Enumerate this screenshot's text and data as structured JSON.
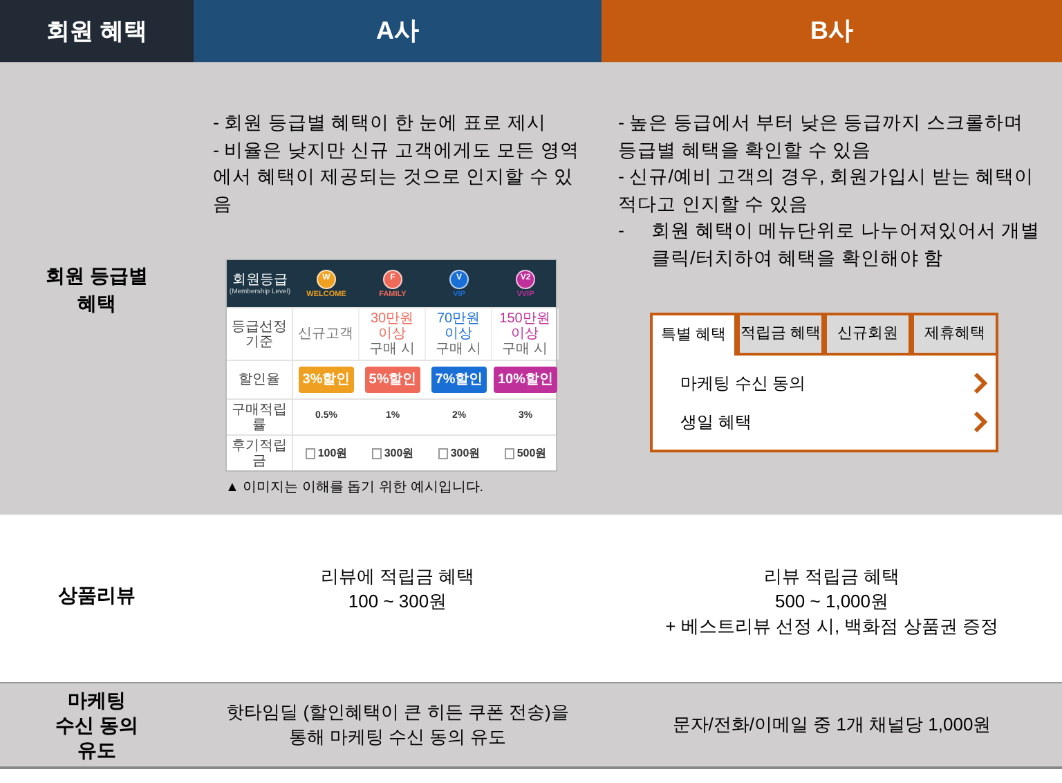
{
  "header": {
    "corner": "회원 혜택",
    "company_a": "A사",
    "company_b": "B사"
  },
  "membership": {
    "label": "회원 등급별\n혜택",
    "a_notes": [
      {
        "kind": "inline",
        "text": "- 회원 등급별 혜택이 한 눈에 표로 제시"
      },
      {
        "kind": "inline",
        "text": "- 비율은 낮지만 신규 고객에게도 모든 영역에서 혜택이 제공되는 것으로 인지할 수 있음"
      }
    ],
    "a_screenshot": {
      "corner_label": "회원등급",
      "corner_sublabel": "(Membership Level)",
      "grades": [
        {
          "letter": "W",
          "name": "WELCOME",
          "color": "#f0a020"
        },
        {
          "letter": "F",
          "name": "FAMILY",
          "color": "#f06a5a"
        },
        {
          "letter": "V",
          "name": "VIP",
          "color": "#1a6fd6"
        },
        {
          "letter": "V2",
          "name": "VVIP",
          "color": "#c0309a"
        }
      ],
      "rows": [
        {
          "kind": "criteria",
          "label": "등급선정기준",
          "cells": [
            {
              "text": "신규고객"
            },
            {
              "text": "30만원 이상",
              "note": "구매 시"
            },
            {
              "text": "70만원 이상",
              "note": "구매 시"
            },
            {
              "text": "150만원 이상",
              "note": "구매 시"
            }
          ]
        },
        {
          "kind": "coupon",
          "label": "할인율",
          "cells": [
            {
              "text": "3%할인"
            },
            {
              "text": "5%할인"
            },
            {
              "text": "7%할인"
            },
            {
              "text": "10%할인"
            }
          ]
        },
        {
          "kind": "rate",
          "label": "구매적립률",
          "cells": [
            {
              "text": "0.5%"
            },
            {
              "text": "1%"
            },
            {
              "text": "2%"
            },
            {
              "text": "3%"
            }
          ]
        },
        {
          "kind": "review",
          "label": "후기적립금",
          "cells": [
            {
              "text": "100원"
            },
            {
              "text": "300원"
            },
            {
              "text": "300원"
            },
            {
              "text": "500원"
            }
          ]
        }
      ],
      "caption": "▲ 이미지는 이해를 돕기 위한 예시입니다."
    },
    "b_notes": [
      {
        "kind": "inline",
        "text": "- 높은 등급에서 부터 낮은 등급까지 스크롤하며 등급별 혜택을 확인할 수 있음"
      },
      {
        "kind": "inline",
        "text": "- 신규/예비 고객의 경우, 회원가입시 받는 혜택이 적다고 인지할 수 있음"
      },
      {
        "kind": "hanging",
        "marker": "-",
        "text": "회원 혜택이 메뉴단위로 나누어져있어서 개별 클릭/터치하여 혜택을 확인해야 함"
      }
    ],
    "b_screenshot": {
      "tabs": [
        {
          "label": "특별 혜택",
          "selected": true
        },
        {
          "label": "적립금 혜택",
          "selected": false
        },
        {
          "label": "신규회원",
          "selected": false
        },
        {
          "label": "제휴혜택",
          "selected": false
        }
      ],
      "items": [
        "마케팅 수신 동의",
        "생일 혜택"
      ]
    }
  },
  "review": {
    "label": "상품리뷰",
    "a_lines": [
      "리뷰에 적립금 혜택",
      "100 ~ 300원"
    ],
    "b_lines": [
      "리뷰 적립금 혜택",
      "500 ~ 1,000원",
      "+ 베스트리뷰 선정 시, 백화점 상품권 증정"
    ]
  },
  "marketing": {
    "label": "마케팅\n수신 동의\n유도",
    "a_lines": [
      "핫타임딜 (할인혜택이 큰 히든 쿠폰 전송)을",
      "통해 마케팅 수신 동의 유도"
    ],
    "b_lines": [
      "문자/전화/이메일 중 1개 채널당 1,000원"
    ]
  }
}
